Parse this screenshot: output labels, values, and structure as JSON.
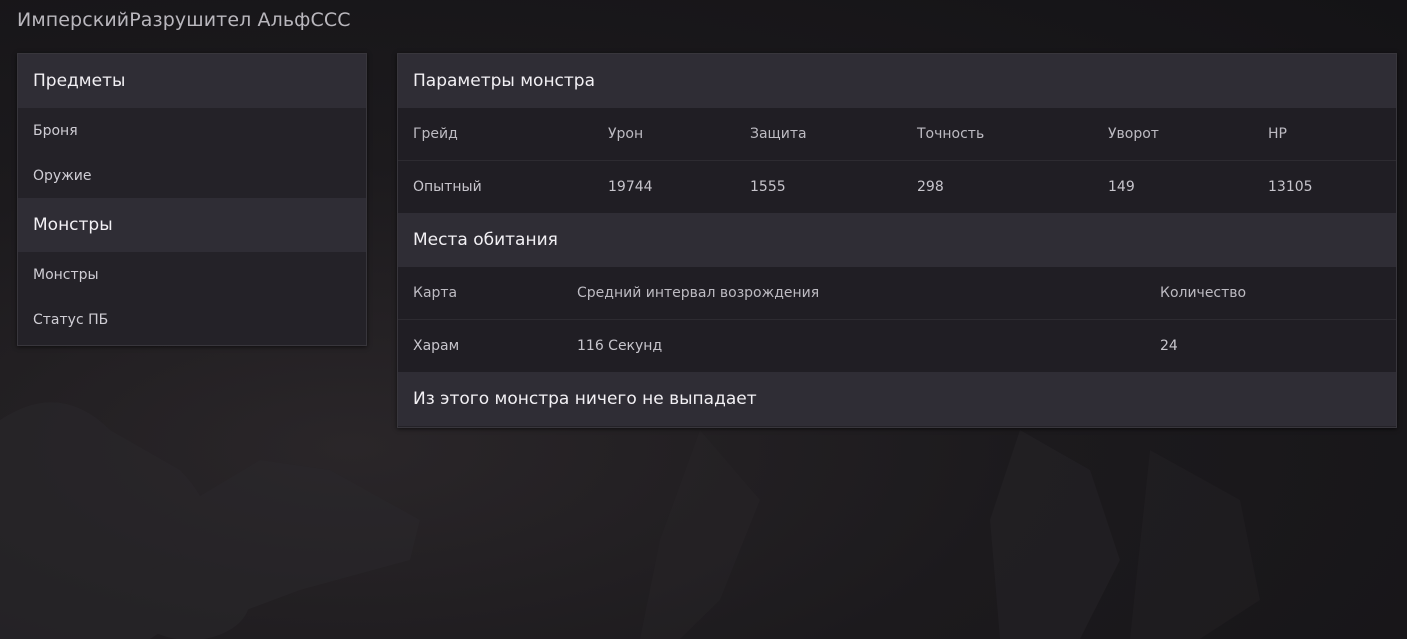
{
  "page_title": "ИмперскийРазрушител АльфССС",
  "sidebar": {
    "sections": [
      {
        "title": "Предметы",
        "items": [
          "Броня",
          "Оружие"
        ]
      },
      {
        "title": "Монстры",
        "items": [
          "Монстры",
          "Статус ПБ"
        ]
      }
    ]
  },
  "stats": {
    "title": "Параметры монстра",
    "headers": [
      "Грейд",
      "Урон",
      "Защита",
      "Точность",
      "Уворот",
      "HP"
    ],
    "values": [
      "Опытный",
      "19744",
      "1555",
      "298",
      "149",
      "13105"
    ]
  },
  "habitat": {
    "title": "Места обитания",
    "headers": [
      "Карта",
      "Средний интервал возрождения",
      "Количество"
    ],
    "rows": [
      [
        "Харам",
        "116 Секунд",
        "24"
      ]
    ]
  },
  "drops": {
    "title": "Из этого монстра ничего не выпадает"
  }
}
